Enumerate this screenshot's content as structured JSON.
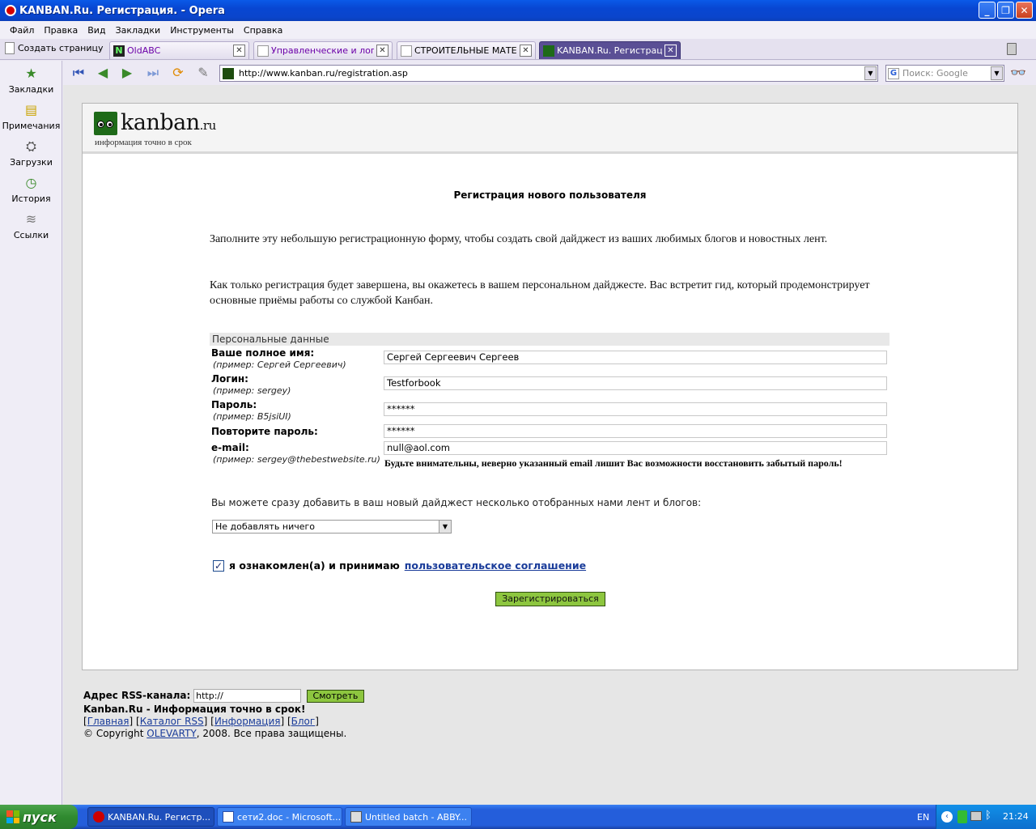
{
  "window": {
    "title": "KANBAN.Ru. Регистрация. - Opera"
  },
  "menu": [
    "Файл",
    "Правка",
    "Вид",
    "Закладки",
    "Инструменты",
    "Справка"
  ],
  "tabs": {
    "new_page": "Создать страницу",
    "items": [
      {
        "label": "OldABC"
      },
      {
        "label": "Управленческие и логи..."
      },
      {
        "label": "СТРОИТЕЛЬНЫЕ МАТЕР..."
      },
      {
        "label": "KANBAN.Ru. Регистрация."
      }
    ]
  },
  "nav": {
    "url": "http://www.kanban.ru/registration.asp",
    "search_placeholder": "Поиск: Google"
  },
  "sidepanel": [
    "Закладки",
    "Примечания",
    "Загрузки",
    "История",
    "Ссылки"
  ],
  "page": {
    "logo_main": "kanban",
    "logo_suffix": ".ru",
    "logo_tagline": "информация точно в срок",
    "title": "Регистрация нового пользователя",
    "intro1": "Заполните эту небольшую регистрационную форму, чтобы создать свой дайджест из ваших любимых блогов и новостных лент.",
    "intro2": "Как только регистрация будет завершена, вы окажетесь в вашем персональном дайджесте. Вас встретит гид, который продемонстрирует основные приёмы работы со службой Канбан.",
    "section": "Персональные данные",
    "fields": {
      "name": {
        "label": "Ваше полное имя:",
        "hint": "(пример: Сергей Сергеевич)",
        "value": "Сергей Сергеевич Сергеев"
      },
      "login": {
        "label": "Логин:",
        "hint": "(пример: sergey)",
        "value": "Testforbook"
      },
      "password": {
        "label": "Пароль:",
        "hint": "(пример: B5jsiUI)",
        "value": "******"
      },
      "password2": {
        "label": "Повторите пароль:",
        "value": "******"
      },
      "email": {
        "label": "e-mail:",
        "hint": "(пример: sergey@thebestwebsite.ru)",
        "value": "null@aol.com"
      }
    },
    "email_warning": "Будьте внимательны, неверно указанный email лишит Вас возможности восстановить забытый пароль!",
    "feeds_label": "Вы можете сразу добавить в ваш новый дайджест несколько отобранных нами лент и блогов:",
    "feeds_select": "Не добавлять ничего",
    "agree_text": "я ознакомлен(а) и принимаю",
    "agree_link": "пользовательское соглашение",
    "agree_checked": true,
    "submit": "Зарегистрироваться"
  },
  "footer": {
    "rss_label": "Адрес RSS-канала:",
    "rss_value": "http://",
    "rss_button": "Смотреть",
    "slogan": "Kanban.Ru - Информация точно в срок!",
    "links": [
      "Главная",
      "Каталог RSS",
      "Информация",
      "Блог"
    ],
    "copyright_pre": "© Copyright",
    "copyright_link": "OLEVARTY",
    "copyright_post": ", 2008. Все права защищены."
  },
  "taskbar": {
    "start": "пуск",
    "tasks": [
      "KANBAN.Ru. Регистр...",
      "сети2.doc - Microsoft...",
      "Untitled batch - ABBY..."
    ],
    "lang": "EN",
    "clock": "21:24"
  },
  "colors": {
    "accent_green": "#8dc63f",
    "link_blue": "#1a3c9a",
    "title_bar": "#0a5ae8"
  }
}
